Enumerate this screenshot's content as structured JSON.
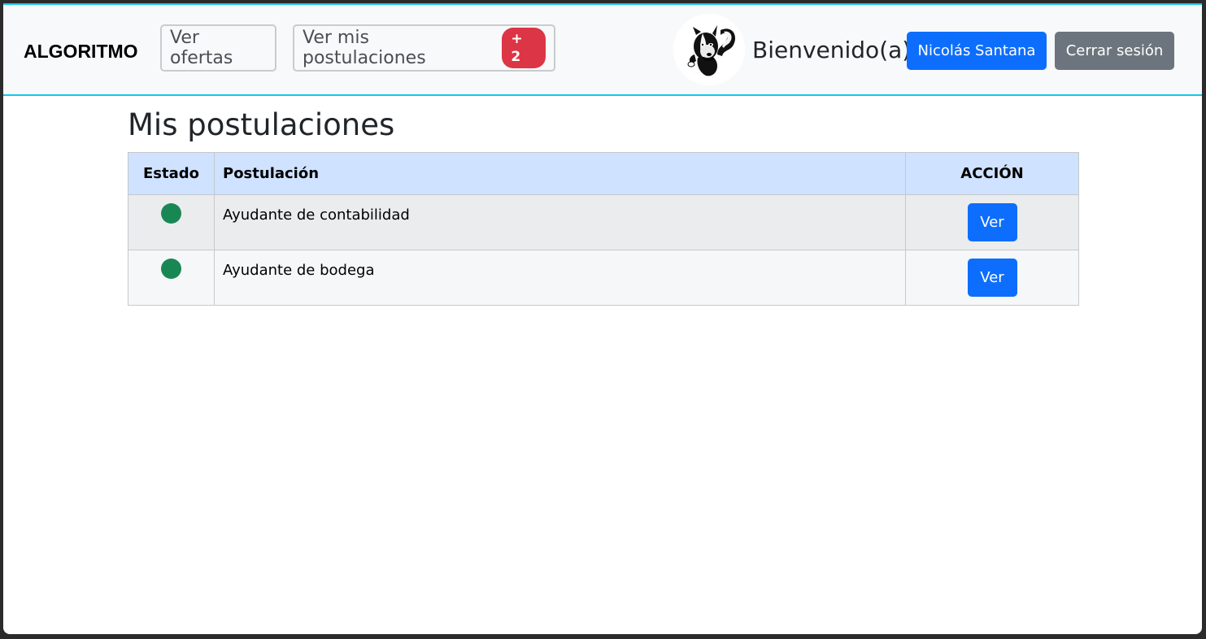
{
  "navbar": {
    "brand": "ALGORITMO",
    "ver_ofertas": "Ver ofertas",
    "ver_postulaciones": "Ver mis postulaciones",
    "postulaciones_badge": "+ 2",
    "welcome": "Bienvenido(a)",
    "user_name": "Nicolás Santana",
    "logout": "Cerrar sesión",
    "avatar_icon": "skunk-avatar-icon"
  },
  "main": {
    "title": "Mis postulaciones",
    "table": {
      "headers": {
        "estado": "Estado",
        "postulacion": "Postulación",
        "accion": "ACCIÓN"
      },
      "rows": [
        {
          "estado_color": "#198754",
          "postulacion": "Ayudante de contabilidad",
          "accion_label": "Ver"
        },
        {
          "estado_color": "#198754",
          "postulacion": "Ayudante de bodega",
          "accion_label": "Ver"
        }
      ]
    }
  },
  "colors": {
    "primary": "#0d6efd",
    "secondary": "#6c757d",
    "danger": "#dc3545",
    "success": "#198754",
    "accent_border": "#0dcaf0",
    "table_header_bg": "#cfe2ff"
  }
}
